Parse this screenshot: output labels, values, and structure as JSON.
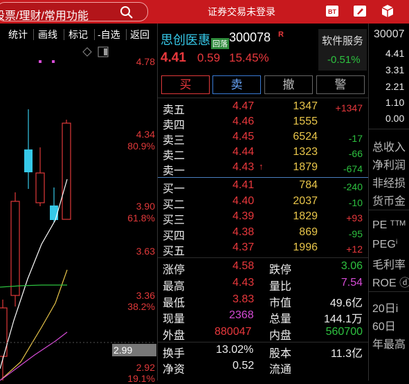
{
  "topbar": {
    "search_text": "股票/理财/常用功能",
    "login_status": "证券交易未登录",
    "icons": [
      "trade-icon",
      "edit-icon",
      "box-icon"
    ]
  },
  "toolbar": {
    "items": [
      "统计",
      "画线",
      "标记",
      "-自选",
      "返回"
    ]
  },
  "chart": {
    "price_labels": [
      {
        "value": "4.78"
      },
      {
        "value": "4.34"
      },
      {
        "value": "80.9%"
      },
      {
        "value": "3.90"
      },
      {
        "value": "61.8%"
      },
      {
        "value": "3.63"
      },
      {
        "value": "3.36"
      },
      {
        "value": "38.2%"
      },
      {
        "value": "2.99"
      },
      {
        "value": "2.92"
      },
      {
        "value": "19.1%"
      }
    ]
  },
  "stock": {
    "name": "思创医惠",
    "tag": "回落",
    "code": "300078",
    "r_mark": "R",
    "price": "4.41",
    "change": "0.59",
    "change_pct": "15.45%",
    "service_label": "软件服务",
    "service_pct": "-0.51%"
  },
  "actions": {
    "buy": "买",
    "sell": "卖",
    "cancel": "撤",
    "alert": "警"
  },
  "asks": [
    {
      "label": "卖五",
      "price": "4.47",
      "volume": "1347",
      "delta": "+1347"
    },
    {
      "label": "卖四",
      "price": "4.46",
      "volume": "1555",
      "delta": ""
    },
    {
      "label": "卖三",
      "price": "4.45",
      "volume": "6524",
      "delta": "-17"
    },
    {
      "label": "卖二",
      "price": "4.44",
      "volume": "1323",
      "delta": "-66"
    },
    {
      "label": "卖一",
      "price": "4.43",
      "volume": "1879",
      "delta": "-674"
    }
  ],
  "bids": [
    {
      "label": "买一",
      "price": "4.41",
      "volume": "784",
      "delta": "-240"
    },
    {
      "label": "买二",
      "price": "4.40",
      "volume": "2037",
      "delta": "-10"
    },
    {
      "label": "买三",
      "price": "4.39",
      "volume": "1829",
      "delta": "+93"
    },
    {
      "label": "买四",
      "price": "4.38",
      "volume": "869",
      "delta": "-95"
    },
    {
      "label": "买五",
      "price": "4.37",
      "volume": "1996",
      "delta": "+12"
    }
  ],
  "stats": {
    "limit_up_label": "涨停",
    "limit_up": "4.58",
    "limit_down_label": "跌停",
    "limit_down": "3.06",
    "high_label": "最高",
    "high": "4.43",
    "vol_ratio_label": "量比",
    "vol_ratio": "7.54",
    "low_label": "最低",
    "low": "3.83",
    "mkt_cap_label": "市值",
    "mkt_cap": "49.6亿",
    "now_vol_label": "现量",
    "now_vol": "2368",
    "total_vol_label": "总量",
    "total_vol": "144.1万",
    "outer_label": "外盘",
    "outer": "880047",
    "inner_label": "内盘",
    "inner": "560700",
    "turnover_label": "换手",
    "turnover": "13.02%",
    "equity_label": "股本",
    "equity": "11.3亿",
    "net_asset_label": "净资",
    "net_asset": "0.52",
    "float_label": "流通",
    "float": ""
  },
  "far_right": {
    "code": "30007",
    "values": [
      "4.41",
      "3.31",
      "2.21",
      "1.10",
      "0.00"
    ],
    "labels": [
      "总收入",
      "净利润",
      "非经损",
      "货币金",
      "PE ᵀᵀᴹ",
      "PEGⁱ",
      "毛利率",
      "ROE ⓓ",
      "20日i",
      "60日",
      "年最高"
    ]
  }
}
